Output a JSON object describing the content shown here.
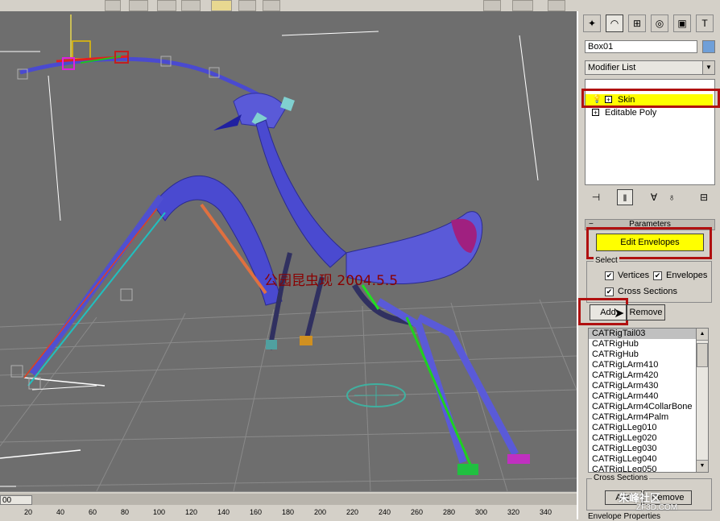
{
  "viewport": {
    "overlay_text": "公园昆虫现 2004.5.5"
  },
  "timeline": {
    "frame_field": "00",
    "ticks": [
      "20",
      "40",
      "60",
      "80",
      "100",
      "120",
      "140",
      "160",
      "180",
      "200",
      "220",
      "240",
      "260",
      "280",
      "300",
      "320",
      "340"
    ]
  },
  "panel": {
    "tabs": [
      "create-icon",
      "modify-icon",
      "hierarchy-icon",
      "motion-icon",
      "display-icon",
      "utilities-icon"
    ],
    "object_name": "Box01",
    "object_color": "#6f9fd8",
    "modifier_list": "Modifier List",
    "stack": [
      {
        "label": "Skin",
        "selected": true
      },
      {
        "label": "Editable Poly",
        "selected": false
      }
    ],
    "rollout_title": "Parameters",
    "edit_envelopes": "Edit Envelopes",
    "select_group": "Select",
    "vertices_label": "Vertices",
    "envelopes_label": "Envelopes",
    "cross_sections_label": "Cross Sections",
    "add_label": "Add",
    "remove_label": "Remove",
    "bones": [
      "CATRigTail03",
      "CATRigHub",
      "CATRigHub",
      "CATRigLArm410",
      "CATRigLArm420",
      "CATRigLArm430",
      "CATRigLArm440",
      "CATRigLArm4CollarBone",
      "CATRigLArm4Palm",
      "CATRigLLeg010",
      "CATRigLLeg020",
      "CATRigLLeg030",
      "CATRigLLeg040",
      "CATRigLLeg050"
    ],
    "cross_sections_group": "Cross Sections",
    "cs_add": "Add",
    "cs_remove": "Remove",
    "next_rollout": "Envelope Properties"
  },
  "watermark": {
    "main": "朱峰社区",
    "sub": "ZF3D.COM"
  }
}
